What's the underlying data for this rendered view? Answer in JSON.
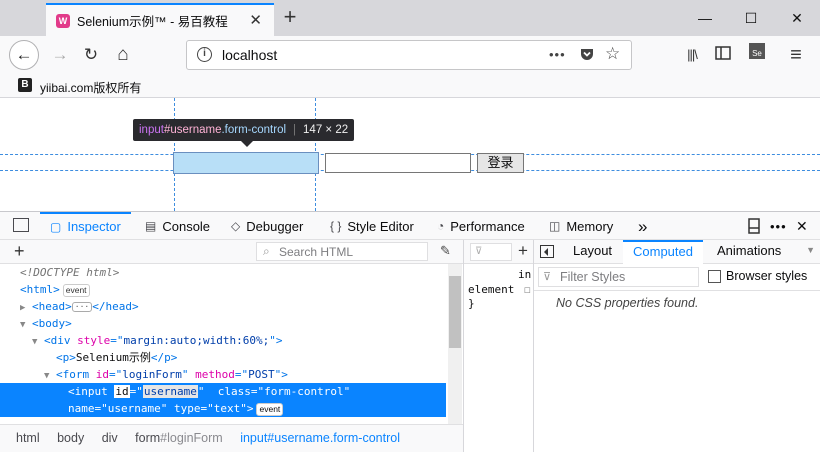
{
  "window": {
    "tab_title": "Selenium示例™ - 易百教程",
    "tab_favicon": "W",
    "new_tab": "+",
    "minimize": "—",
    "maximize": "☐",
    "close": "✕"
  },
  "nav": {
    "back": "←",
    "forward": "→",
    "reload": "↻",
    "home": "⌂",
    "url": "localhost",
    "page_actions": "•••",
    "library": "|||\\",
    "sidebar": "▯▯",
    "menu": "≡"
  },
  "bookmarks": {
    "icon_letter": "B",
    "label": "yiibai.com版权所有"
  },
  "content": {
    "tooltip": {
      "tag": "input",
      "id": "#username",
      "class": ".form-control",
      "dimensions": "147 × 22"
    },
    "submit_label": "登录"
  },
  "devtools": {
    "tools": [
      {
        "icon": "▢",
        "label": "Inspector"
      },
      {
        "icon": "▤",
        "label": "Console"
      },
      {
        "icon": "◇",
        "label": "Debugger"
      },
      {
        "icon": "{ }",
        "label": "Style Editor"
      },
      {
        "icon": "◔",
        "label": "Performance"
      },
      {
        "icon": "◫",
        "label": "Memory"
      }
    ],
    "more_tools": "»",
    "markup": {
      "search_placeholder": "Search HTML",
      "doctype": "<!DOCTYPE html>",
      "html_tag": "html",
      "head_tag": "head",
      "body_tag": "body",
      "div_tag": "div",
      "div_style_attr": "style",
      "div_style_val": "margin:auto;width:60%;",
      "p_tag": "p",
      "p_text": "Selenium示例",
      "form_tag": "form",
      "form_id_attr": "id",
      "form_id_val": "loginForm",
      "form_method_attr": "method",
      "form_method_val": "POST",
      "input_tag": "input",
      "input_id_attr": "id",
      "input_id_val": "username",
      "input_class_attr": "class",
      "input_class_val": "form-control",
      "input_name_attr": "name",
      "input_name_val": "username",
      "input_type_attr": "type",
      "input_type_val": "text",
      "event_badge": "event"
    },
    "breadcrumb": [
      {
        "tag": "html",
        "id": ""
      },
      {
        "tag": "body",
        "id": ""
      },
      {
        "tag": "div",
        "id": ""
      },
      {
        "tag": "form",
        "id": "#loginForm"
      },
      {
        "tag": "input",
        "id": "#username.form-control"
      }
    ],
    "rules": {
      "line1": "in",
      "line2": "element",
      "line3": "}"
    },
    "sidebar": {
      "tabs": [
        "Layout",
        "Computed",
        "Animations"
      ],
      "active_tab": "Computed",
      "filter_placeholder": "Filter Styles",
      "browser_styles_label": "Browser styles",
      "empty_message": "No CSS properties found."
    }
  },
  "colors": {
    "accent": "#0a84ff",
    "highlight_fill": "#b8dff7",
    "guide_line": "#3e8ddf"
  }
}
